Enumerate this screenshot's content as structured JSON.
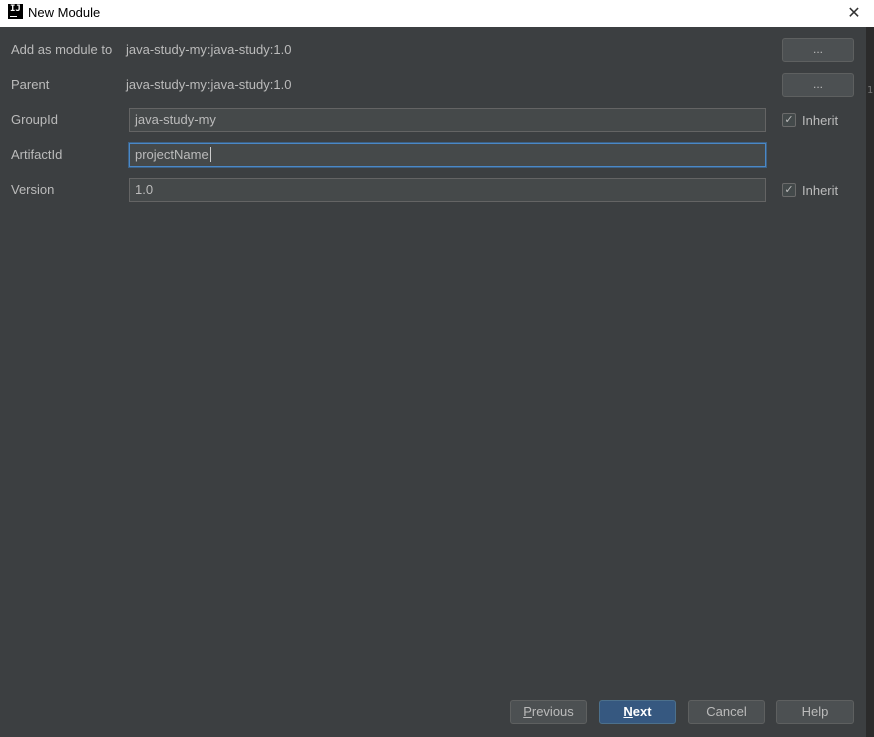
{
  "window": {
    "title": "New Module",
    "app_icon_text": "IJ",
    "close_glyph": "✕",
    "edge_fragment": "1"
  },
  "form": {
    "add_as_module": {
      "label": "Add as module to",
      "value": "java-study-my:java-study:1.0",
      "button": "..."
    },
    "parent": {
      "label": "Parent",
      "value": "java-study-my:java-study:1.0",
      "button": "..."
    },
    "group_id": {
      "label": "GroupId",
      "value": "java-study-my",
      "inherit_label": "Inherit",
      "inherit_checked": true
    },
    "artifact_id": {
      "label": "ArtifactId",
      "value": "projectName"
    },
    "version": {
      "label": "Version",
      "value": "1.0",
      "inherit_label": "Inherit",
      "inherit_checked": true
    }
  },
  "footer": {
    "previous": {
      "mnemonic": "P",
      "rest": "revious"
    },
    "next": {
      "mnemonic": "N",
      "rest": "ext"
    },
    "cancel": "Cancel",
    "help": "Help"
  },
  "colors": {
    "background": "#3c3f41",
    "field_background": "#45494a",
    "primary_button": "#365880",
    "focus_border": "#4a88c7"
  }
}
